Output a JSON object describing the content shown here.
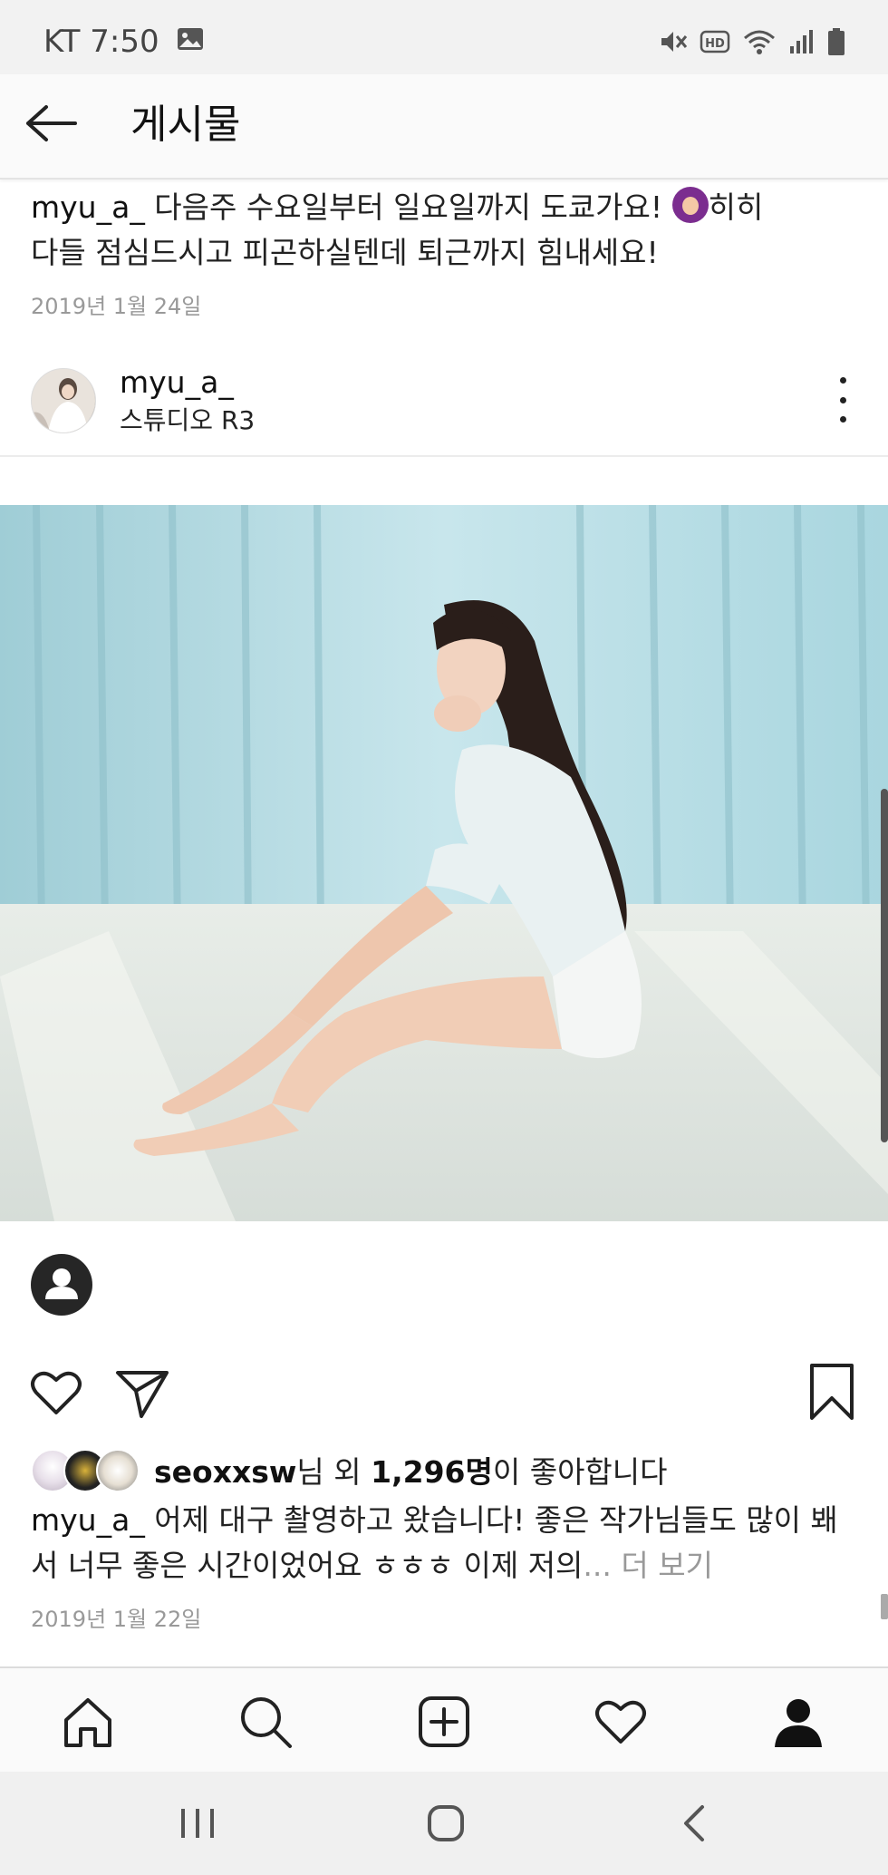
{
  "status_bar": {
    "carrier_time": "KT 7:50",
    "icons": [
      "image-icon",
      "mute-vibrate-icon",
      "hd-icon",
      "wifi-icon",
      "signal-icon",
      "battery-icon"
    ]
  },
  "header": {
    "back_icon": "arrow-left-icon",
    "title": "게시물"
  },
  "previous_post": {
    "username": "myu_a_",
    "caption_line1": " 다음주 수요일부터 일요일까지 도쿄가요! ",
    "caption_line1_after": "히히",
    "caption_line2": "다들 점심드시고 피곤하실텐데 퇴근까지 힘내세요!",
    "date": "2019년 1월 24일"
  },
  "post": {
    "username": "myu_a_",
    "location": "스튜디오 R3",
    "likes_user": "seoxxsw",
    "likes_mid": "님 외 ",
    "likes_count": "1,296명",
    "likes_suffix": "이 좋아합니다",
    "caption_username": "myu_a_",
    "caption_text": " 어제 대구 촬영하고 왔습니다! 좋은 작가님들도 많이 봬서 너무 좋은 시간이었어요 ㅎㅎㅎ 이제 저의",
    "caption_more": "... 더 보기",
    "date": "2019년 1월 22일"
  },
  "bottom_nav": [
    "home-icon",
    "search-icon",
    "add-post-icon",
    "activity-heart-icon",
    "profile-icon"
  ],
  "system_nav": [
    "recent-apps-icon",
    "home-button-icon",
    "back-icon"
  ],
  "colors": {
    "text": "#111111",
    "muted": "#999999",
    "divider": "#e3e3e3",
    "image_sky": "#bfe3ea"
  }
}
